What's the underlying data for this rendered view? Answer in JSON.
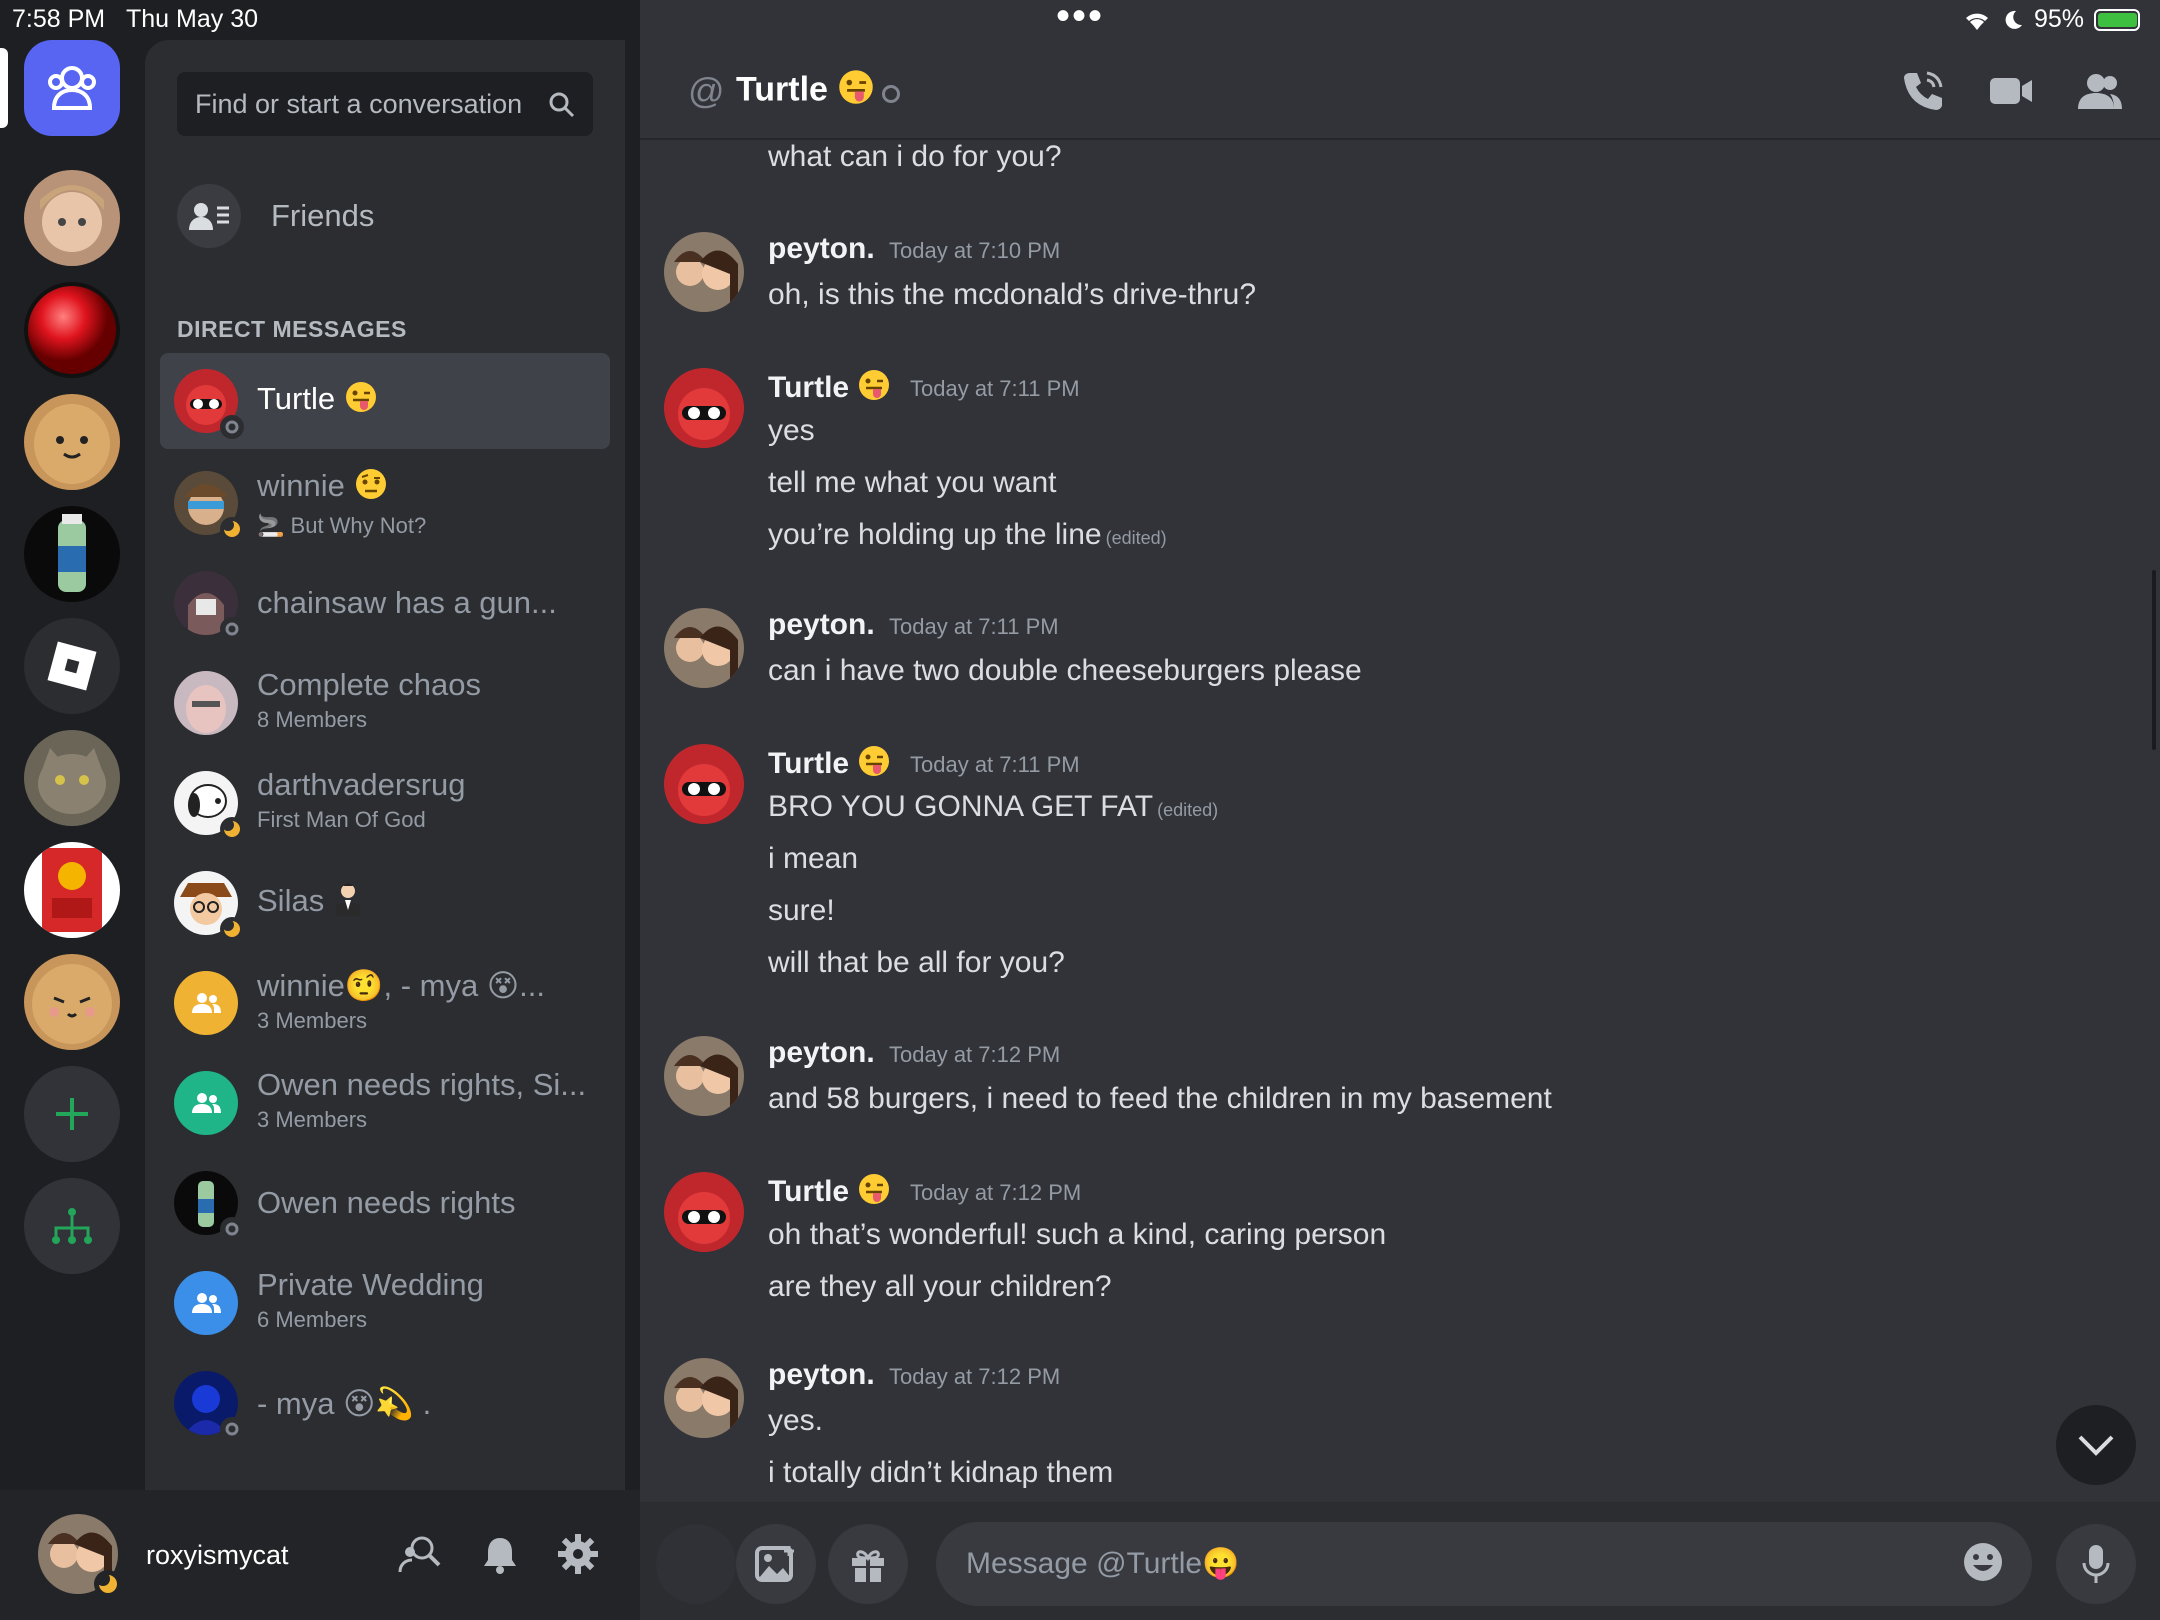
{
  "status_bar": {
    "time": "7:58 PM",
    "date": "Thu May 30",
    "battery": "95%",
    "battery_level": 0.95
  },
  "search": {
    "placeholder": "Find or start a conversation"
  },
  "friends_label": "Friends",
  "dm_header": "DIRECT MESSAGES",
  "dms": [
    {
      "name": "Turtle",
      "emoji": "tongue",
      "sub": "",
      "active": true,
      "status": "offline"
    },
    {
      "name": "winnie",
      "emoji": "raised-eyebrow",
      "sub": "But Why Not?",
      "status": "idle"
    },
    {
      "name": "chainsaw has a gun...",
      "sub": "",
      "status": "offline"
    },
    {
      "name": "Complete chaos",
      "sub": "8 Members",
      "status": "none"
    },
    {
      "name": "darthvadersrug",
      "sub": "First Man Of God",
      "status": "idle"
    },
    {
      "name": "Silas",
      "emoji": "man-in-suit",
      "sub": "",
      "status": "idle"
    },
    {
      "name": "winnie🤨, - mya 😵...",
      "sub": "3 Members",
      "status": "none",
      "group_color": "#f0b232"
    },
    {
      "name": "Owen needs rights, Si...",
      "sub": "3 Members",
      "status": "none",
      "group_color": "#1fb589"
    },
    {
      "name": "Owen needs rights",
      "sub": "",
      "status": "offline"
    },
    {
      "name": "Private Wedding",
      "sub": "6 Members",
      "status": "none",
      "group_color": "#3b8fe8"
    },
    {
      "name": "- mya 😵💫 .",
      "sub": "",
      "status": "offline"
    }
  ],
  "user": {
    "name": "roxyismycat"
  },
  "chat": {
    "at_symbol": "@",
    "recipient": "Turtle",
    "recipient_emoji": "tongue",
    "composer_placeholder": "Message @Turtle😛",
    "edited_label": "(edited)",
    "orphan_line": "what can i do for you?",
    "messages": [
      {
        "author": "peyton.",
        "time": "Today at 7:10 PM",
        "lines": [
          "oh, is this the mcdonald’s drive-thru?"
        ]
      },
      {
        "author": "Turtle",
        "time": "Today at 7:11 PM",
        "lines": [
          "yes",
          "tell me what you want",
          "you’re holding up the line"
        ],
        "edited_line": 2
      },
      {
        "author": "peyton.",
        "time": "Today at 7:11 PM",
        "lines": [
          "can i have two double cheeseburgers please"
        ]
      },
      {
        "author": "Turtle",
        "time": "Today at 7:11 PM",
        "lines": [
          "BRO YOU GONNA GET FAT",
          "i mean",
          "sure!",
          "will that be all for you?"
        ],
        "edited_line": 0
      },
      {
        "author": "peyton.",
        "time": "Today at 7:12 PM",
        "lines": [
          "and 58 burgers, i need to feed the children in my basement"
        ]
      },
      {
        "author": "Turtle",
        "time": "Today at 7:12 PM",
        "lines": [
          "oh that’s wonderful! such a kind, caring person",
          "are they all your children?"
        ]
      },
      {
        "author": "peyton.",
        "time": "Today at 7:12 PM",
        "lines": [
          "yes.",
          "i totally didn’t kidnap them"
        ]
      }
    ]
  },
  "colors": {
    "blurple": "#5865f2",
    "green": "#23a55a",
    "idle": "#f0b232",
    "bg_chat": "#313338",
    "bg_panel": "#2b2d31"
  }
}
